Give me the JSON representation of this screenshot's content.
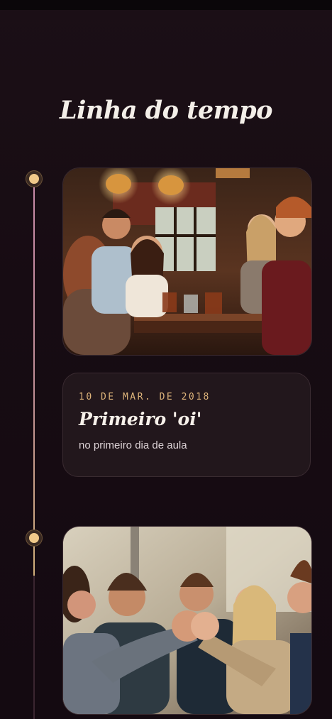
{
  "page": {
    "title": "Linha do tempo"
  },
  "timeline": {
    "events": [
      {
        "photo_icon": "friends-at-restaurant-photo",
        "date": "10 DE MAR. DE 2018",
        "title": "Primeiro 'oi'",
        "subtitle": "no primeiro dia de aula"
      },
      {
        "photo_icon": "friends-fist-bump-photo"
      }
    ]
  },
  "colors": {
    "background": "#170c13",
    "accent_gold": "#e0b67c",
    "line_pink": "#c98aa9",
    "card": "#22171c"
  }
}
